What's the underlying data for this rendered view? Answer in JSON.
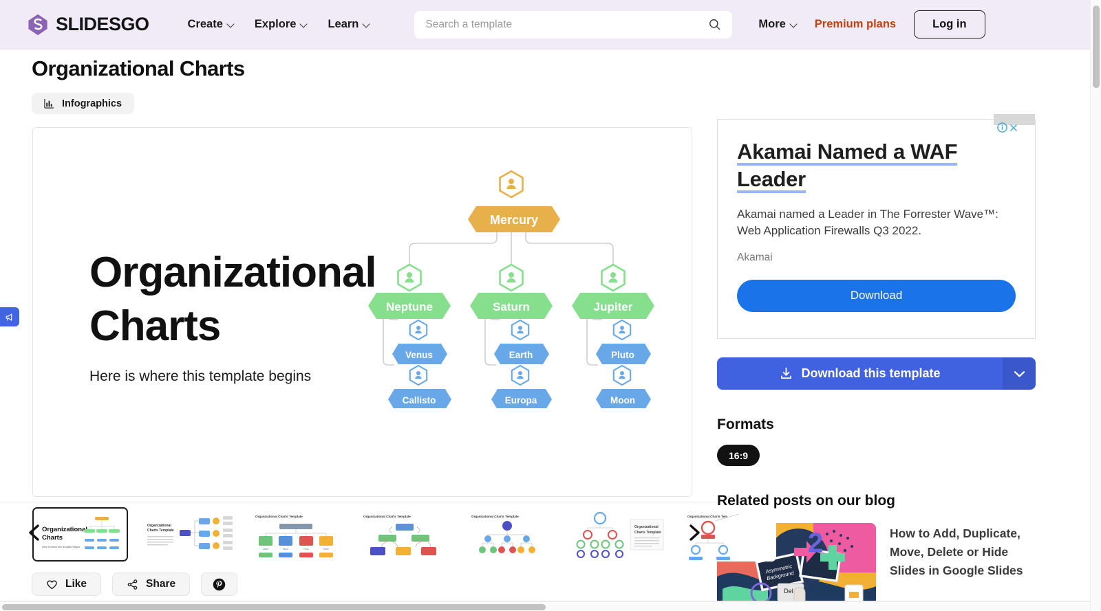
{
  "header": {
    "logo_text": "SLIDESGO",
    "nav": [
      {
        "label": "Create"
      },
      {
        "label": "Explore"
      },
      {
        "label": "Learn"
      }
    ],
    "search": {
      "placeholder": "Search a template",
      "value": ""
    },
    "more_label": "More",
    "premium_label": "Premium plans",
    "login_label": "Log in"
  },
  "page": {
    "title": "Organizational Charts",
    "tag_label": "Infographics"
  },
  "slide": {
    "title_line1": "Organizational",
    "title_line2": "Charts",
    "subtitle": "Here is where this template begins",
    "chart_data": {
      "type": "diagram",
      "title": "Organizational Charts",
      "levels": 3,
      "root": {
        "label": "Mercury",
        "color": "#e8b04b",
        "level": 0
      },
      "nodes": [
        {
          "label": "Mercury",
          "level": 0,
          "parent": null,
          "color": "#e8b04b"
        },
        {
          "label": "Neptune",
          "level": 1,
          "parent": "Mercury",
          "color": "#86df8c"
        },
        {
          "label": "Saturn",
          "level": 1,
          "parent": "Mercury",
          "color": "#86df8c"
        },
        {
          "label": "Jupiter",
          "level": 1,
          "parent": "Mercury",
          "color": "#86df8c"
        },
        {
          "label": "Venus",
          "level": 2,
          "parent": "Neptune",
          "color": "#69a8e8"
        },
        {
          "label": "Callisto",
          "level": 2,
          "parent": "Neptune",
          "color": "#69a8e8"
        },
        {
          "label": "Earth",
          "level": 2,
          "parent": "Saturn",
          "color": "#69a8e8"
        },
        {
          "label": "Europa",
          "level": 2,
          "parent": "Saturn",
          "color": "#69a8e8"
        },
        {
          "label": "Pluto",
          "level": 2,
          "parent": "Jupiter",
          "color": "#69a8e8"
        },
        {
          "label": "Moon",
          "level": 2,
          "parent": "Jupiter",
          "color": "#69a8e8"
        }
      ]
    }
  },
  "ad": {
    "title_line1": "Akamai Named a WAF",
    "title_line2": "Leader",
    "description": "Akamai named a Leader in The Forrester Wave™: Web Application Firewalls Q3 2022.",
    "advertiser": "Akamai",
    "cta_label": "Download"
  },
  "sidebar": {
    "download_label": "Download this template",
    "formats_title": "Formats",
    "formats": [
      "16:9"
    ],
    "related_title": "Related posts on our blog",
    "related_posts": [
      {
        "title": "How to Add, Duplicate, Move, Delete or Hide Slides in Google Slides"
      }
    ]
  },
  "carousel": {
    "thumbnails": [
      {
        "caption": "Organizational Charts",
        "sub": "Here is where this template begins",
        "active": true
      },
      {
        "caption": "Organizational Charts Template",
        "active": false
      },
      {
        "caption": "Organizational Charts Template",
        "active": false
      },
      {
        "caption": "Organizational Charts Template",
        "active": false
      },
      {
        "caption": "Organizational Charts Template",
        "active": false
      },
      {
        "caption": "Organizational Charts Template",
        "active": false
      },
      {
        "caption": "Organizational Charts Template",
        "active": false
      }
    ]
  },
  "actions": {
    "like_label": "Like",
    "share_label": "Share",
    "pinterest_label": ""
  },
  "colors": {
    "header_bg": "#f1ebf7",
    "brand_purple": "#8a63b5",
    "premium_orange": "#c2410c",
    "primary_blue": "#4162e0",
    "ad_blue": "#1a73e8",
    "node_orange": "#e8b04b",
    "node_green": "#86df8c",
    "node_blue": "#69a8e8"
  }
}
